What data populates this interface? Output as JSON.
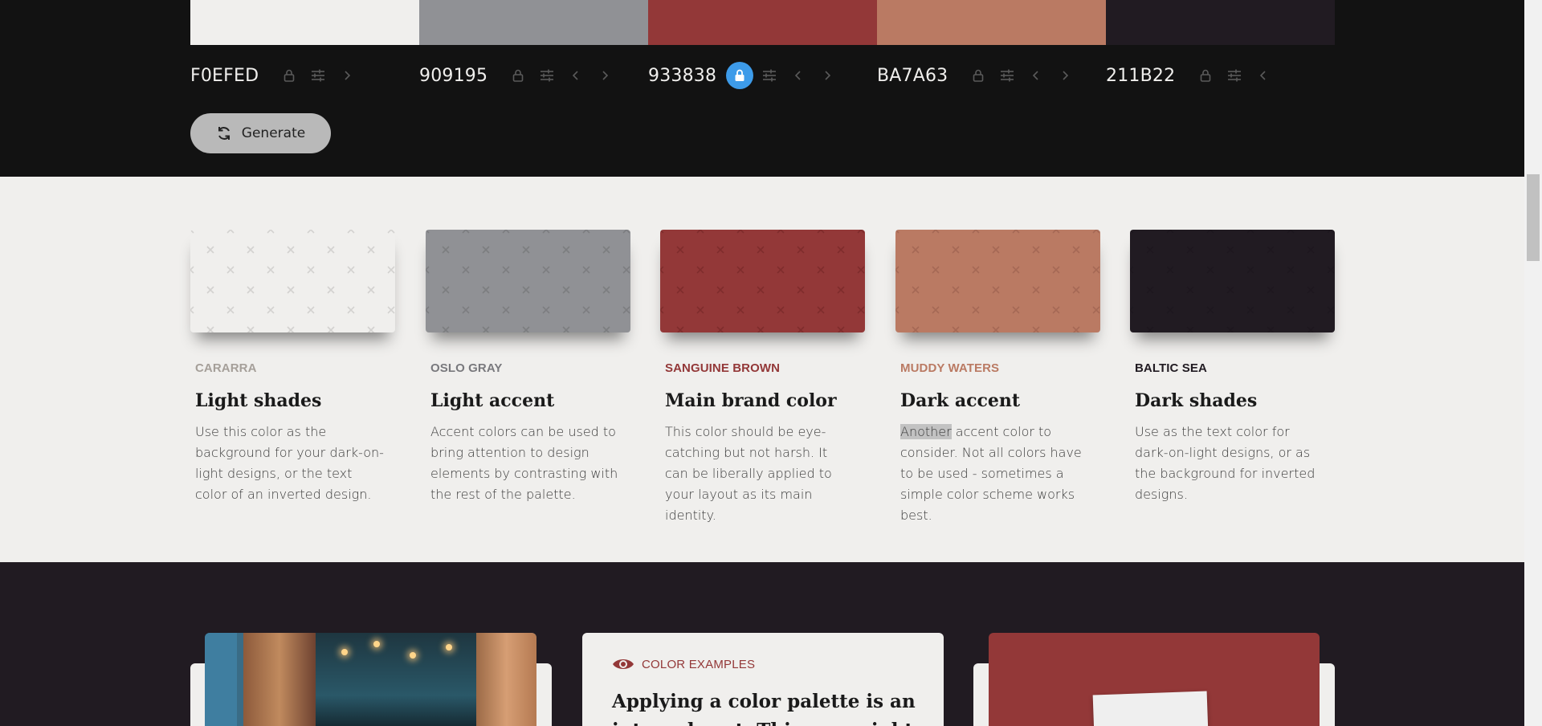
{
  "palette": {
    "swatches": [
      {
        "hex": "F0EFED",
        "color": "#f0efed",
        "locked": false,
        "has_prev": false,
        "has_next": true
      },
      {
        "hex": "909195",
        "color": "#909195",
        "locked": false,
        "has_prev": true,
        "has_next": true
      },
      {
        "hex": "933838",
        "color": "#933838",
        "locked": true,
        "has_prev": true,
        "has_next": true
      },
      {
        "hex": "BA7A63",
        "color": "#ba7a63",
        "locked": false,
        "has_prev": true,
        "has_next": true
      },
      {
        "hex": "211B22",
        "color": "#211b22",
        "locked": false,
        "has_prev": true,
        "has_next": false
      }
    ],
    "generate_label": "Generate",
    "accent_lock_color": "#3d9be9"
  },
  "cards": [
    {
      "name": "CARARRA",
      "name_color": "#a59f99",
      "title": "Light shades",
      "desc": "Use this color as the background for your dark-on-light designs, or the text color of an inverted design.",
      "color": "#f0efed",
      "pattern": "#d3d2d0"
    },
    {
      "name": "OSLO GRAY",
      "name_color": "#79797d",
      "title": "Light accent",
      "desc": "Accent colors can be used to bring attention to design elements by contrasting with the rest of the palette.",
      "color": "#909195",
      "pattern": "#7c7d80"
    },
    {
      "name": "SANGUINE BROWN",
      "name_color": "#933838",
      "title": "Main brand color",
      "desc": "This color should be eye-catching but not harsh. It can be liberally applied to your layout as its main identity.",
      "color": "#933838",
      "pattern": "#7f2c2c"
    },
    {
      "name": "MUDDY WATERS",
      "name_color": "#ba7a63",
      "title": "Dark accent",
      "desc_highlight": "Another",
      "desc": " accent color to consider. Not all colors have to be used - sometimes a simple color scheme works best.",
      "color": "#ba7a63",
      "pattern": "#a56855"
    },
    {
      "name": "BALTIC SEA",
      "name_color": "#211b22",
      "title": "Dark shades",
      "desc": "Use as the text color for dark-on-light designs, or as the background for inverted designs.",
      "color": "#211b22",
      "pattern": "#1d171e"
    }
  ],
  "examples": {
    "label": "COLOR EXAMPLES",
    "title": "Applying a color palette is an integral part. This one might"
  }
}
